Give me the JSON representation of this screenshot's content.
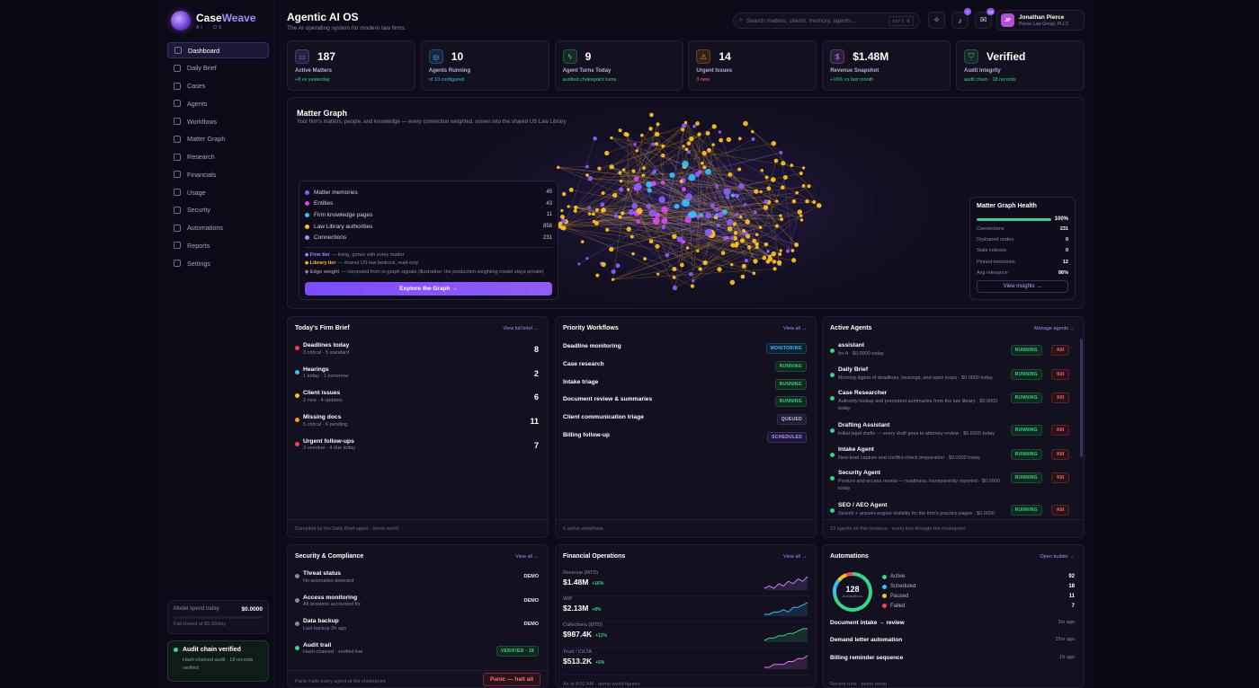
{
  "brand": {
    "name_a": "Case",
    "name_b": "Weave",
    "tagline": "AI · OS"
  },
  "sidebar": {
    "items": [
      {
        "label": "Dashboard",
        "icon": "home-icon"
      },
      {
        "label": "Daily Brief",
        "icon": "doc-icon"
      },
      {
        "label": "Cases",
        "icon": "briefcase-icon"
      },
      {
        "label": "Agents",
        "icon": "bot-icon"
      },
      {
        "label": "Workflows",
        "icon": "workflow-icon"
      },
      {
        "label": "Matter Graph",
        "icon": "graph-icon"
      },
      {
        "label": "Research",
        "icon": "search-icon"
      },
      {
        "label": "Financials",
        "icon": "dollar-icon"
      },
      {
        "label": "Usage",
        "icon": "chart-icon"
      },
      {
        "label": "Security",
        "icon": "shield-icon"
      },
      {
        "label": "Automations",
        "icon": "sparkle-icon"
      },
      {
        "label": "Reports",
        "icon": "report-icon"
      },
      {
        "label": "Settings",
        "icon": "gear-icon"
      }
    ],
    "spend": {
      "label": "Model spend today",
      "value": "$0.0000",
      "fraction": 0.0,
      "note": "Fail closed at $5.00/day"
    },
    "audit": {
      "title": "Audit chain verified",
      "sub": "Hash-chained audit · 18 records verified"
    }
  },
  "header": {
    "title": "Agentic AI OS",
    "subtitle": "The AI operating system for modern law firms.",
    "search_placeholder": "Search matters, clients, memory, agents…",
    "search_kbd": "ctrl K",
    "notif_count": "7",
    "inbox_count": "12",
    "user": {
      "initials": "JP",
      "name": "Jonathan Pierce",
      "firm": "Pierce Law Group, PLLC"
    }
  },
  "kpis": [
    {
      "value": "187",
      "label": "Active Matters",
      "sub": "+8 vs yesterday",
      "color": "#a68cff",
      "icon": "folder-icon",
      "glyph": "▭"
    },
    {
      "value": "10",
      "label": "Agents Running",
      "sub": "of 10 configured",
      "color": "#38bdf8",
      "icon": "bot-icon",
      "glyph": "◎"
    },
    {
      "value": "9",
      "label": "Agent Turns Today",
      "sub": "audited chokepoint turns",
      "color": "#3ad18a",
      "icon": "bolt-icon",
      "glyph": "ϟ"
    },
    {
      "value": "14",
      "label": "Urgent Issues",
      "sub": "3 new",
      "color": "#f59e0b",
      "icon": "warning-icon",
      "glyph": "⚠"
    },
    {
      "value": "$1.48M",
      "label": "Revenue Snapshot",
      "sub": "+16% vs last month",
      "color": "#c084fc",
      "icon": "dollar-icon",
      "glyph": "$"
    },
    {
      "value": "Verified",
      "label": "Audit Integrity",
      "sub": "audit chain · 18 records",
      "color": "#3ad18a",
      "icon": "shield-icon",
      "glyph": "⛉"
    }
  ],
  "graph": {
    "title": "Matter Graph",
    "subtitle": "Your firm's matters, people, and knowledge — every connection weighted, woven into the shared US Law Library",
    "legend": [
      {
        "label": "Matter memories",
        "value": "45",
        "color": "#8b5cf6"
      },
      {
        "label": "Entities",
        "value": "43",
        "color": "#d946ef"
      },
      {
        "label": "Firm knowledge pages",
        "value": "11",
        "color": "#38bdf8"
      },
      {
        "label": "Law Library authorities",
        "value": "858",
        "color": "#fbbf24"
      },
      {
        "label": "Connections",
        "value": "231",
        "color": "#a78bfa"
      }
    ],
    "notes": [
      {
        "key": "◆ Firm tier",
        "text": " — living, grows with every matter",
        "color": "#a68cff"
      },
      {
        "key": "◆ Library tier",
        "text": " — shared US law bedrock, read-only",
        "color": "#fbbf24"
      },
      {
        "key": "◆ Edge weight",
        "text": " — computed from in-graph signals (illustrative; the production weighting model stays private)",
        "color": "#8c86a8"
      }
    ],
    "explore_label": "Explore the Graph →",
    "health": {
      "title": "Matter Graph Health",
      "percent": "100%",
      "fraction": 1.0,
      "rows": [
        {
          "label": "Connections",
          "value": "231"
        },
        {
          "label": "Orphaned nodes",
          "value": "0"
        },
        {
          "label": "Stale indexes",
          "value": "0"
        },
        {
          "label": "Pinned memories",
          "value": "12"
        },
        {
          "label": "Avg relevance",
          "value": "86%"
        }
      ],
      "button": "View insights →"
    }
  },
  "brief": {
    "title": "Today's Firm Brief",
    "link": "View full brief →",
    "items": [
      {
        "title": "Deadlines today",
        "sub": "3 critical · 5 standard",
        "count": "8",
        "color": "#f43f5e"
      },
      {
        "title": "Hearings",
        "sub": "1 today · 1 tomorrow",
        "count": "2",
        "color": "#38bdf8"
      },
      {
        "title": "Client issues",
        "sub": "2 new · 4 updates",
        "count": "6",
        "color": "#fbbf24"
      },
      {
        "title": "Missing docs",
        "sub": "5 critical · 6 pending",
        "count": "11",
        "color": "#f59e0b"
      },
      {
        "title": "Urgent follow-ups",
        "sub": "3 overdue · 4 due today",
        "count": "7",
        "color": "#f43f5e"
      }
    ],
    "footer": "Compiled by the Daily Brief agent · demo world"
  },
  "workflows": {
    "title": "Priority Workflows",
    "link": "View all →",
    "items": [
      {
        "title": "Deadline monitoring",
        "status": "MONITORING",
        "kind": "mon"
      },
      {
        "title": "Case research",
        "status": "RUNNING",
        "kind": "run"
      },
      {
        "title": "Intake triage",
        "status": "RUNNING",
        "kind": "run"
      },
      {
        "title": "Document review & summaries",
        "status": "RUNNING",
        "kind": "run"
      },
      {
        "title": "Client communication triage",
        "status": "QUEUED",
        "kind": "q"
      },
      {
        "title": "Billing follow-up",
        "status": "SCHEDULED",
        "kind": "s"
      }
    ],
    "footer": "6 active workflows"
  },
  "agents": {
    "title": "Active Agents",
    "link": "Manage agents →",
    "items": [
      {
        "title": "assistant",
        "sub": "for A · $0.0000 today",
        "status": "RUNNING"
      },
      {
        "title": "Daily Brief",
        "sub": "Morning digest of deadlines, hearings, and open loops · $0.0000 today",
        "status": "RUNNING"
      },
      {
        "title": "Case Researcher",
        "sub": "Authority lookup and precedent summaries from the law library · $0.0000 today",
        "status": "RUNNING"
      },
      {
        "title": "Drafting Assistant",
        "sub": "Initial legal drafts — every draft goes to attorney review · $0.0000 today",
        "status": "RUNNING"
      },
      {
        "title": "Intake Agent",
        "sub": "New-lead capture and conflict-check preparation · $0.0000 today",
        "status": "RUNNING"
      },
      {
        "title": "Security Agent",
        "sub": "Posture and access review — readiness, transparently reported · $0.0000 today",
        "status": "RUNNING"
      },
      {
        "title": "SEO / AEO Agent",
        "sub": "Search + answer-engine visibility for the firm's practice pages · $0.0000",
        "status": "RUNNING"
      }
    ],
    "kill_label": "Kill",
    "footer": "10 agents on this instance · every turn through the chokepoint"
  },
  "security": {
    "title": "Security & Compliance",
    "link": "View all →",
    "items": [
      {
        "title": "Threat status",
        "sub": "No anomalies detected",
        "tag": "DEMO",
        "color": "#8c86a8"
      },
      {
        "title": "Access monitoring",
        "sub": "All sessions accounted for",
        "tag": "DEMO",
        "color": "#8c86a8"
      },
      {
        "title": "Data backup",
        "sub": "Last backup 2h ago",
        "tag": "DEMO",
        "color": "#8c86a8"
      },
      {
        "title": "Audit trail",
        "sub": "Hash-chained · verified live",
        "tag": "VERIFIED · 18",
        "color": "#3ad18a"
      }
    ],
    "footer": "Panic halts every agent at the chokepoint",
    "panic": "Panic — halt all"
  },
  "finance": {
    "title": "Financial Operations",
    "link": "View all →",
    "items": [
      {
        "label": "Revenue (MTD)",
        "value": "$1.48M",
        "delta": "+16%",
        "color": "#c084fc",
        "spark": [
          3,
          4,
          3,
          5,
          4,
          6,
          5,
          7,
          6,
          8
        ]
      },
      {
        "label": "WIP",
        "value": "$2.13M",
        "delta": "+8%",
        "color": "#38bdf8",
        "spark": [
          3,
          3,
          4,
          4,
          5,
          4,
          6,
          6,
          7,
          8
        ]
      },
      {
        "label": "Collections (MTD)",
        "value": "$987.4K",
        "delta": "+11%",
        "color": "#3ad18a",
        "spark": [
          2,
          3,
          3,
          4,
          4,
          5,
          5,
          6,
          7,
          7
        ]
      },
      {
        "label": "Trust / IOLTA",
        "value": "$513.2K",
        "delta": "+5%",
        "color": "#e879f9",
        "spark": [
          3,
          3,
          4,
          4,
          4,
          5,
          5,
          6,
          6,
          7
        ]
      }
    ],
    "footer": "As of 8:02 AM · demo world figures"
  },
  "automations": {
    "title": "Automations",
    "link": "Open builder →",
    "total": "128",
    "total_label": "automations",
    "status": [
      {
        "label": "Active",
        "value": 92,
        "color": "#3ad18a"
      },
      {
        "label": "Scheduled",
        "value": 18,
        "color": "#38bdf8"
      },
      {
        "label": "Paused",
        "value": 11,
        "color": "#fbbf24"
      },
      {
        "label": "Failed",
        "value": 7,
        "color": "#f43f5e"
      }
    ],
    "runs": [
      {
        "title": "Document intake → review",
        "time": "2m ago"
      },
      {
        "title": "Demand letter automation",
        "time": "15m ago"
      },
      {
        "title": "Billing reminder sequence",
        "time": "1h ago"
      }
    ],
    "footer": "Recent runs · demo world"
  }
}
